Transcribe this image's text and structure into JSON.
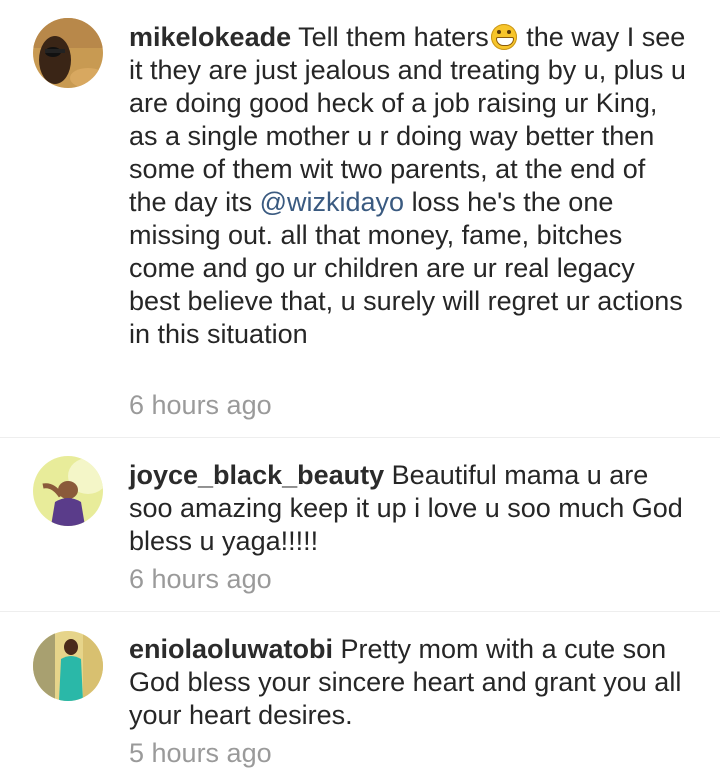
{
  "comments": [
    {
      "username": "mikelokeade",
      "text_before_emoji": "Tell them haters",
      "emoji": "grinning-face-emoji",
      "text_before_mention": "the way I see it they are just jealous and treating by u, plus u are doing good heck of a job raising ur King, as a single mother u r doing way better then some of them wit two parents, at the end of the day its",
      "mention": "@wizkidayo",
      "text_after_mention": "loss he's the one missing out. all that money, fame, bitches come and go ur children are ur real legacy best believe that, u surely will regret ur actions in this situation",
      "time": "6 hours ago"
    },
    {
      "username": "joyce_black_beauty",
      "text": "Beautiful  mama  u are soo  amazing  keep  it  up  i  love  u soo  much God  bless  u  yaga!!!!!",
      "time": "6 hours ago"
    },
    {
      "username": "eniolaoluwatobi",
      "text": "Pretty mom with a cute son God bless your sincere heart and grant you all your heart desires.",
      "time": "5 hours ago"
    }
  ]
}
